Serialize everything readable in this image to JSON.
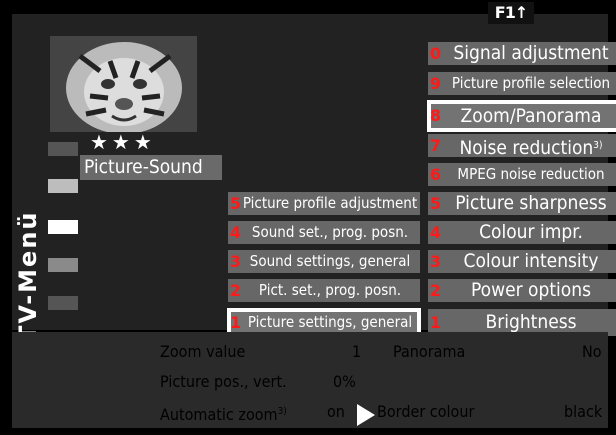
{
  "badge": {
    "text": "F1↑"
  },
  "preview": {
    "rating": "★★★"
  },
  "sidebar": {
    "title": "TV-Menü",
    "category_label": "Picture-Sound"
  },
  "mid_menu": {
    "items": [
      {
        "num": "5",
        "label": "Picture profile adjustment"
      },
      {
        "num": "4",
        "label": "Sound set., prog. posn."
      },
      {
        "num": "3",
        "label": "Sound settings, general"
      },
      {
        "num": "2",
        "label": "Pict. set., prog. posn."
      },
      {
        "num": "1",
        "label": "Picture settings, general"
      }
    ]
  },
  "right_menu": {
    "items": [
      {
        "num": "0",
        "label": "Signal adjustment"
      },
      {
        "num": "9",
        "label": "Picture profile selection"
      },
      {
        "num": "8",
        "label": "Zoom/Panorama"
      },
      {
        "num": "7",
        "label": "Noise reduction",
        "footnote": "3)"
      },
      {
        "num": "6",
        "label": "MPEG noise reduction"
      },
      {
        "num": "5",
        "label": "Picture sharpness"
      },
      {
        "num": "4",
        "label": "Colour impr."
      },
      {
        "num": "3",
        "label": "Colour intensity"
      },
      {
        "num": "2",
        "label": "Power options"
      },
      {
        "num": "1",
        "label": "Brightness"
      }
    ]
  },
  "info": {
    "zoom_label": "Zoom value",
    "zoom_value": "1",
    "panorama_label": "Panorama",
    "panorama_value": "No",
    "picpos_label": "Picture pos., vert.",
    "picpos_value": "0%",
    "autozoom_label": "Automatic zoom",
    "autozoom_footnote": "3)",
    "autozoom_value": "on",
    "border_label": "Border colour",
    "border_value": "black"
  },
  "colors": {
    "accent_number": "#ff1a1a",
    "menu_bg": "#676767",
    "panel_bg": "#222222",
    "selection": "#ffffff"
  }
}
